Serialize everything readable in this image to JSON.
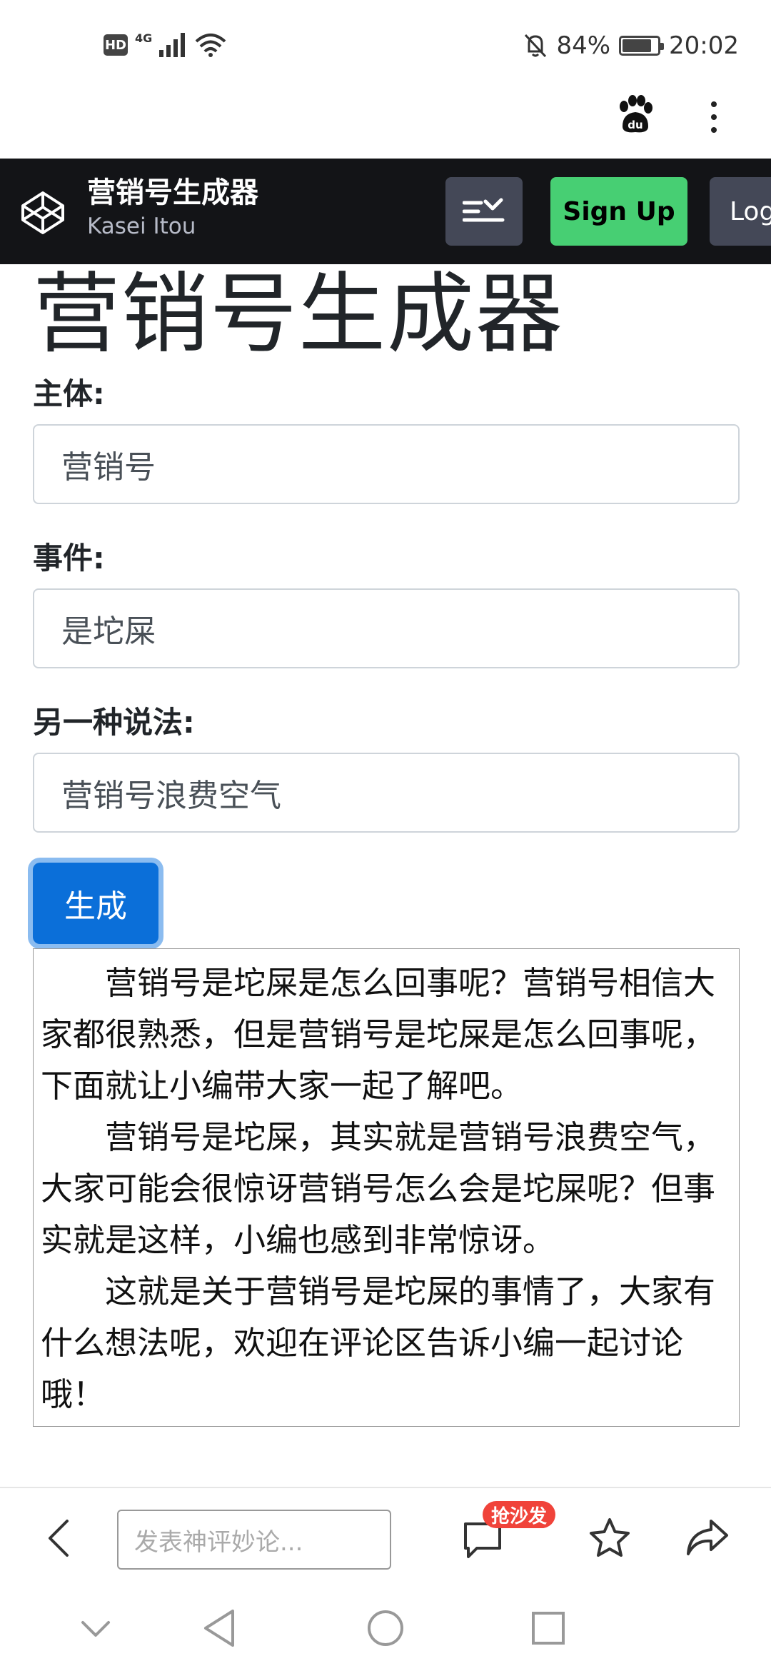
{
  "status_bar": {
    "hd": "HD",
    "network": "4G",
    "battery_percent": "84%",
    "battery_level": 0.84,
    "time": "20:02"
  },
  "browser_bar": {
    "baidu_logo_text": "du"
  },
  "site_header": {
    "title": "营销号生成器",
    "author": "Kasei Itou",
    "signup_label": "Sign Up",
    "login_label": "Log"
  },
  "main": {
    "heading": "营销号生成器",
    "fields": [
      {
        "label": "主体:",
        "value": "营销号"
      },
      {
        "label": "事件:",
        "value": "是坨屎"
      },
      {
        "label": "另一种说法:",
        "value": "营销号浪费空气"
      }
    ],
    "generate_label": "生成",
    "output_paragraphs": [
      "营销号是坨屎是怎么回事呢？营销号相信大家都很熟悉，但是营销号是坨屎是怎么回事呢，下面就让小编带大家一起了解吧。",
      "营销号是坨屎，其实就是营销号浪费空气，大家可能会很惊讶营销号怎么会是坨屎呢？但事实就是这样，小编也感到非常惊讶。",
      "这就是关于营销号是坨屎的事情了，大家有什么想法呢，欢迎在评论区告诉小编一起讨论哦！"
    ]
  },
  "bottom_toolbar": {
    "comment_placeholder": "发表神评妙论...",
    "sofa_badge": "抢沙发"
  },
  "colors": {
    "header_bg": "#131417",
    "signup_green": "#47cf73",
    "primary_blue": "#0b6fd9",
    "badge_red": "#f0433a"
  }
}
